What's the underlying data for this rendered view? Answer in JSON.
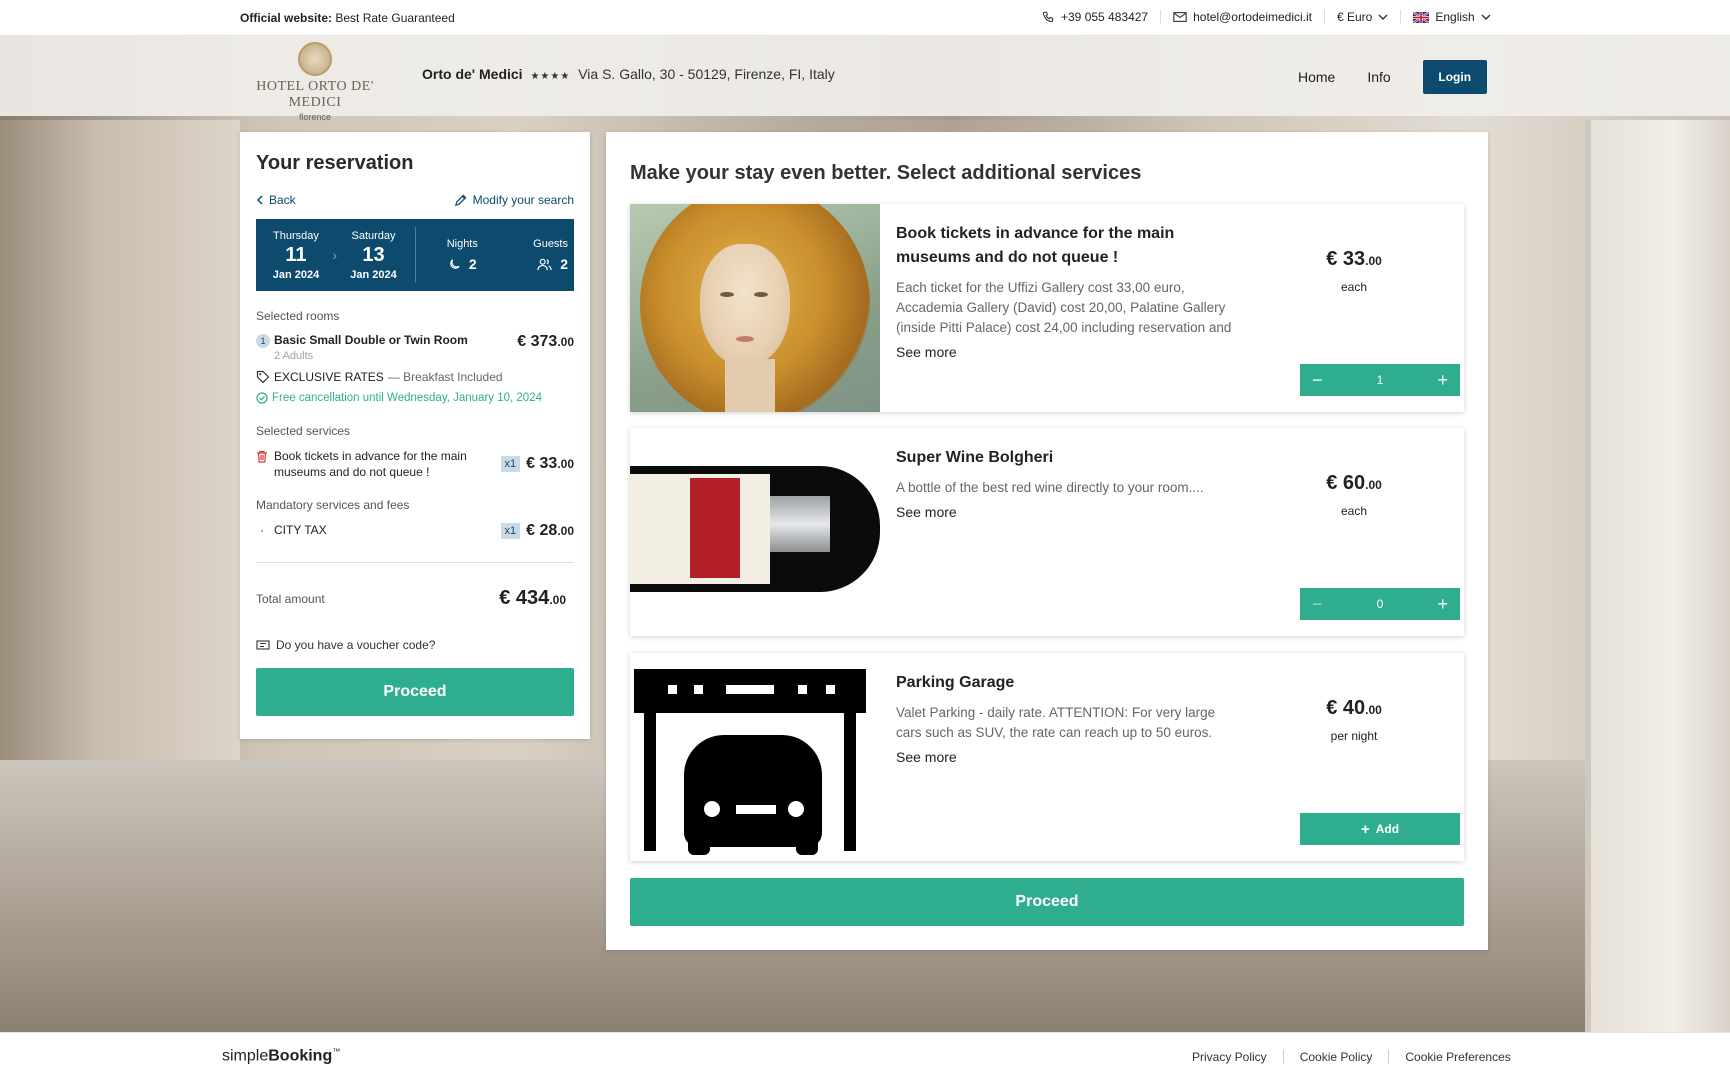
{
  "topbar": {
    "official_label": "Official website:",
    "official_text": "Best Rate Guaranteed",
    "phone": "+39 055 483427",
    "email": "hotel@ortodeimedici.it",
    "currency": "€ Euro",
    "language": "English"
  },
  "header": {
    "logo_name": "HOTEL ORTO DE' MEDICI",
    "logo_city": "florence",
    "hotel_name": "Orto de' Medici",
    "stars": "★★★★",
    "address": "Via S. Gallo, 30 - 50129, Firenze, FI, Italy",
    "nav": {
      "home": "Home",
      "info": "Info",
      "login": "Login"
    }
  },
  "reservation": {
    "title": "Your reservation",
    "back": "Back",
    "modify": "Modify your search",
    "checkin": {
      "dow": "Thursday",
      "day": "11",
      "month": "Jan 2024"
    },
    "checkout": {
      "dow": "Saturday",
      "day": "13",
      "month": "Jan 2024"
    },
    "nights_label": "Nights",
    "nights": "2",
    "guests_label": "Guests",
    "guests": "2",
    "selected_rooms_label": "Selected rooms",
    "room": {
      "index": "1",
      "name": "Basic Small Double or Twin Room",
      "adults": "2 Adults",
      "price": "€ 373",
      "price_dec": ".00",
      "rate": "EXCLUSIVE RATES",
      "rate_extra": "— Breakfast Included",
      "cancellation": "Free cancellation until Wednesday, January 10, 2024"
    },
    "selected_services_label": "Selected services",
    "service": {
      "name": "Book tickets in advance for the main museums and do not queue !",
      "qty": "x1",
      "price": "€ 33",
      "price_dec": ".00"
    },
    "mandatory_label": "Mandatory services and fees",
    "fee": {
      "name": "CITY TAX",
      "qty": "x1",
      "price": "€ 28",
      "price_dec": ".00"
    },
    "total_label": "Total amount",
    "total": "€ 434",
    "total_dec": ".00",
    "voucher": "Do you have a voucher code?",
    "proceed": "Proceed"
  },
  "services": {
    "title": "Make your stay even better. Select additional services",
    "items": [
      {
        "name": "Book tickets in advance for the main museums and do not queue !",
        "description": "Each ticket for the Uffizi Gallery cost 33,00 euro, Accademia Gallery (David) cost 20,00, Palatine Gallery (inside Pitti Palace) cost 24,00 including reservation and ticket. Tickets...",
        "see_more": "See more",
        "price": "€ 33",
        "price_dec": ".00",
        "unit": "each",
        "quantity": "1"
      },
      {
        "name": "Super Wine Bolgheri",
        "description": "A bottle of the best red wine directly to your room....",
        "see_more": "See more",
        "price": "€ 60",
        "price_dec": ".00",
        "unit": "each",
        "quantity": "0"
      },
      {
        "name": "Parking Garage",
        "description": "Valet Parking - daily rate. ATTENTION: For very large cars such as SUV, the rate can reach up to 50 euros.",
        "see_more": "See more",
        "price": "€ 40",
        "price_dec": ".00",
        "unit": "per night",
        "add_label": "Add"
      }
    ],
    "proceed": "Proceed"
  },
  "footer": {
    "brand_light": "simple",
    "brand_bold": "Booking",
    "brand_tm": "™",
    "privacy": "Privacy Policy",
    "cookie": "Cookie Policy",
    "preferences": "Cookie Preferences"
  },
  "colors": {
    "primary": "#0c4a6e",
    "accent": "#2fae8f"
  },
  "icons": [
    "phone-icon",
    "mail-icon",
    "chevron-down-icon",
    "uk-flag-icon",
    "chevron-left-icon",
    "pencil-icon",
    "moon-icon",
    "guests-icon",
    "tag-icon",
    "check-circle-icon",
    "trash-icon",
    "voucher-icon",
    "minus-icon",
    "plus-icon"
  ]
}
